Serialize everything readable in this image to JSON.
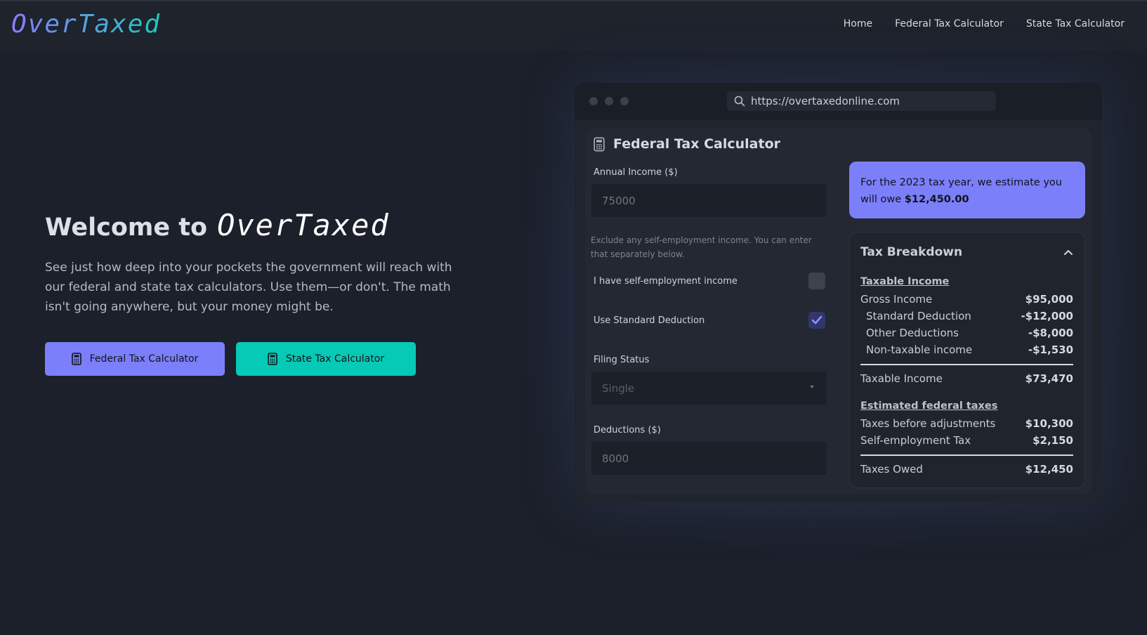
{
  "nav": {
    "logo": "OverTaxed",
    "links": [
      "Home",
      "Federal Tax Calculator",
      "State Tax Calculator"
    ]
  },
  "hero": {
    "title_prefix": "Welcome to",
    "title_brand": "OverTaxed",
    "description": "See just how deep into your pockets the government will reach with our federal and state tax calculators. Use them—or don't. The math isn't going anywhere, but your money might be.",
    "buttons": {
      "federal": "Federal Tax Calculator",
      "state": "State Tax Calculator"
    }
  },
  "browser": {
    "url": "https://overtaxedonline.com"
  },
  "calculator": {
    "title": "Federal Tax Calculator",
    "annual_income_label": "Annual Income ($)",
    "annual_income_value": "75000",
    "hint": "Exclude any self-employment income. You can enter that separately below.",
    "self_employment_label": "I have self-employment income",
    "self_employment_checked": false,
    "standard_deduction_label": "Use Standard Deduction",
    "standard_deduction_checked": true,
    "filing_status_label": "Filing Status",
    "filing_status_value": "Single",
    "deductions_label": "Deductions ($)",
    "deductions_value": "8000"
  },
  "estimate": {
    "text": "For the 2023 tax year, we estimate you will owe",
    "amount": "$12,450.00"
  },
  "breakdown": {
    "title": "Tax Breakdown",
    "taxable_section": "Taxable Income",
    "gross_income": {
      "label": "Gross Income",
      "value": "$95,000"
    },
    "standard_deduction": {
      "label": "Standard Deduction",
      "value": "-$12,000"
    },
    "other_deductions": {
      "label": "Other Deductions",
      "value": "-$8,000"
    },
    "non_taxable": {
      "label": "Non-taxable income",
      "value": "-$1,530"
    },
    "taxable_income": {
      "label": "Taxable Income",
      "value": "$73,470"
    },
    "federal_section": "Estimated federal taxes",
    "taxes_before": {
      "label": "Taxes before adjustments",
      "value": "$10,300"
    },
    "self_employment_tax": {
      "label": "Self-employment Tax",
      "value": "$2,150"
    },
    "taxes_owed": {
      "label": "Taxes Owed",
      "value": "$12,450"
    }
  },
  "colors": {
    "accent_purple": "#7c7ffa",
    "accent_teal": "#06cab5",
    "background": "#1b202a"
  }
}
